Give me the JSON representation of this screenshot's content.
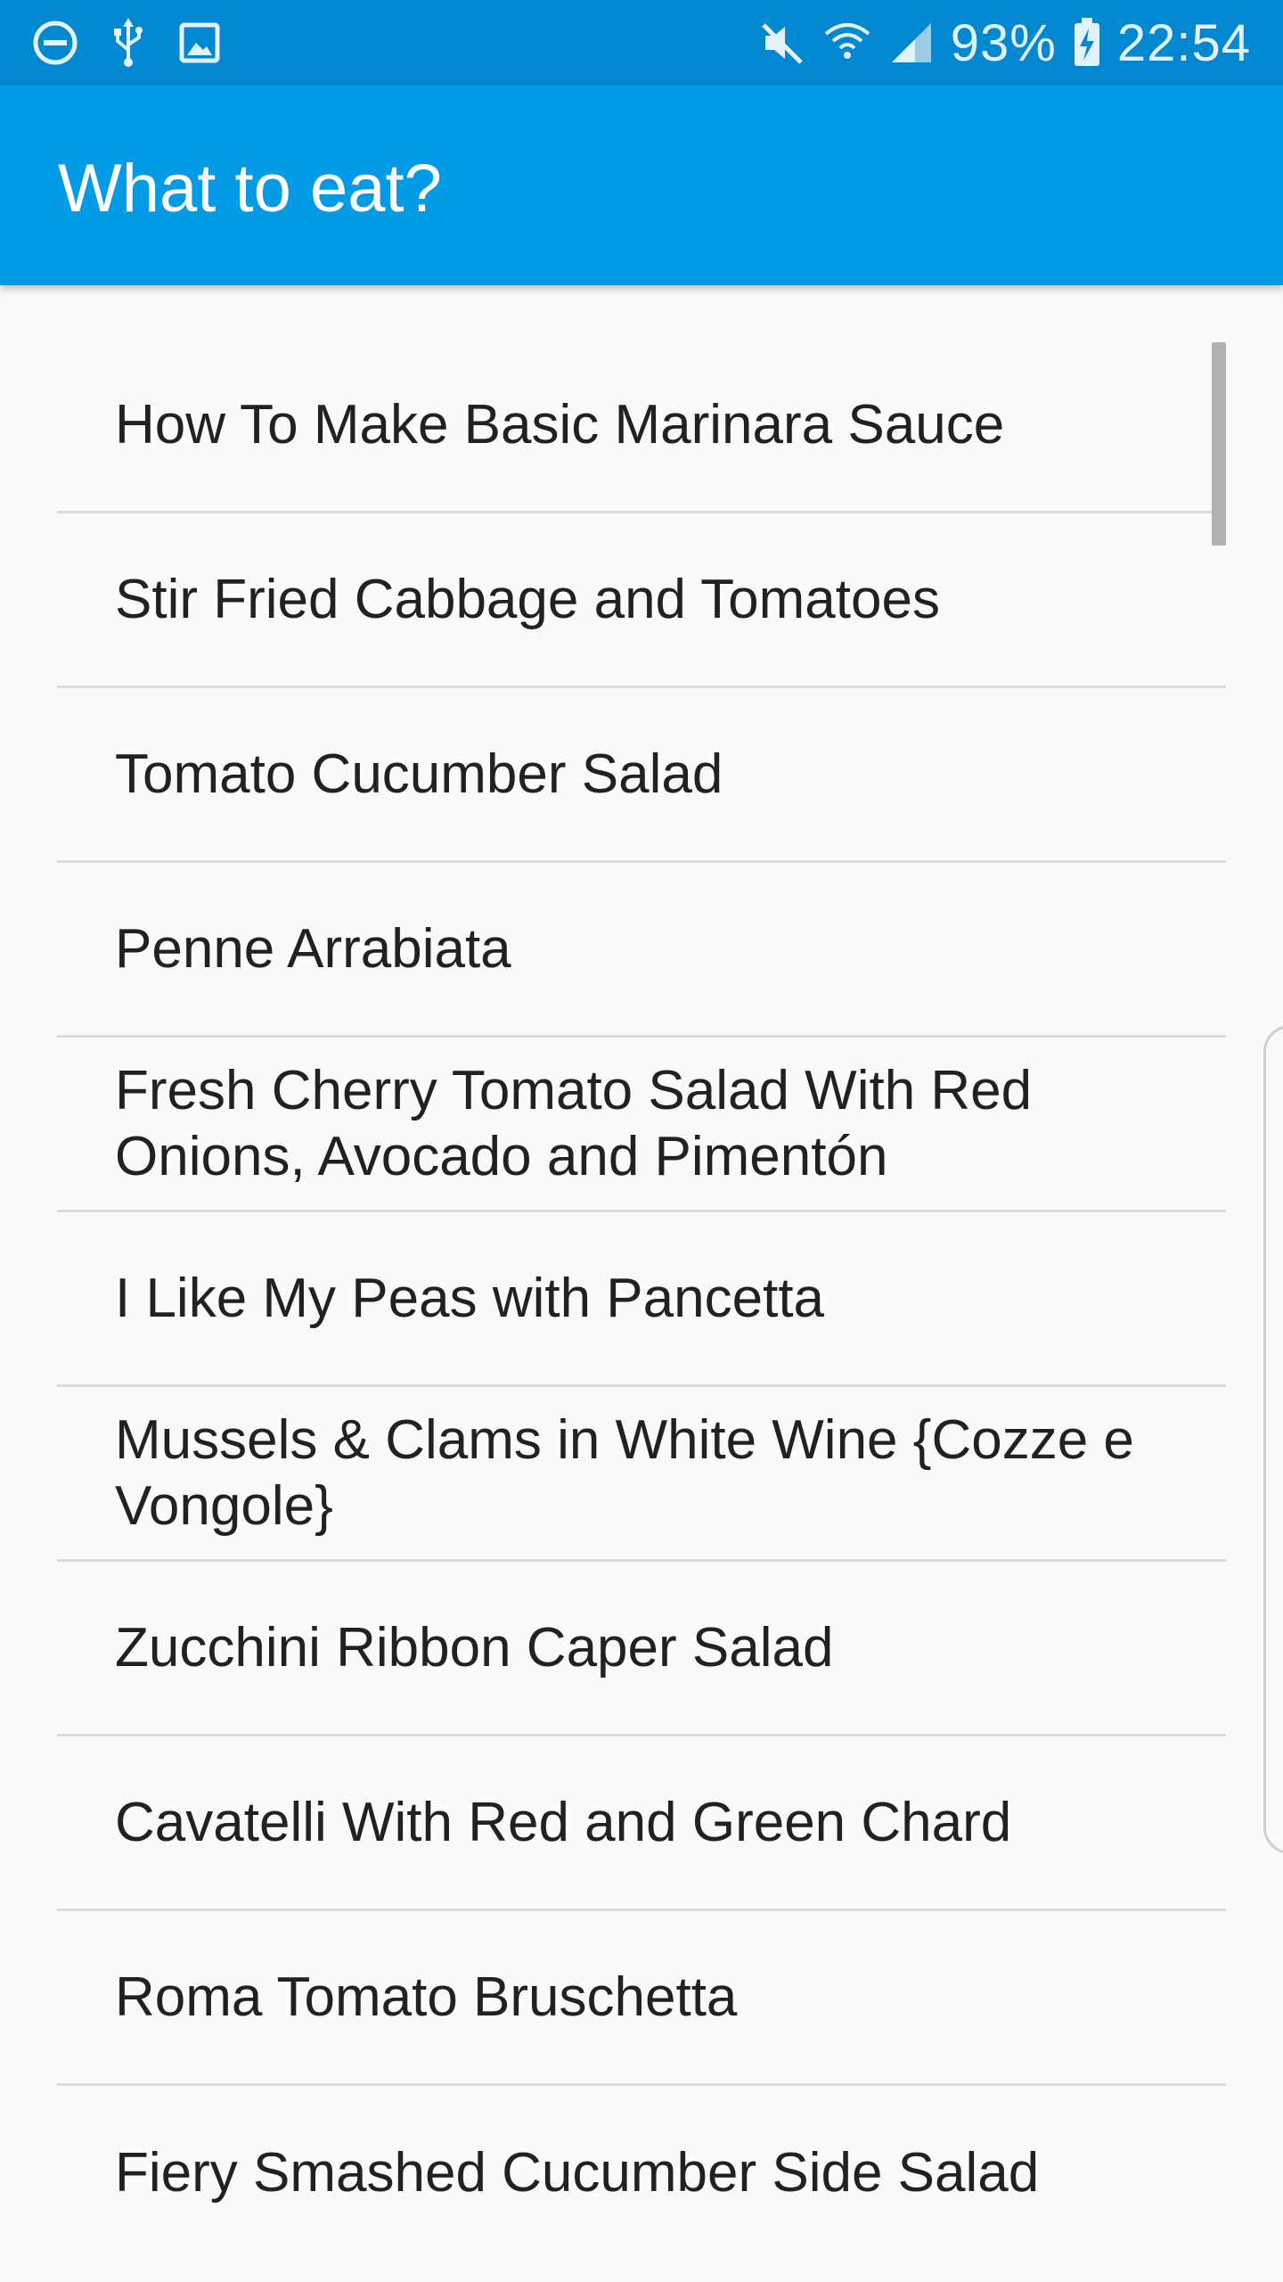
{
  "status_bar": {
    "battery": "93%",
    "time": "22:54",
    "icons_left": [
      "do-not-disturb-icon",
      "usb-icon",
      "image-icon"
    ],
    "icons_right": [
      "mute-icon",
      "wifi-icon",
      "signal-icon",
      "battery-charging-icon"
    ]
  },
  "app_bar": {
    "title": "What to eat?"
  },
  "recipes": [
    "How To Make Basic Marinara Sauce",
    "Stir Fried Cabbage and Tomatoes",
    "Tomato Cucumber Salad",
    "Penne Arrabiata",
    "Fresh Cherry Tomato Salad With Red Onions, Avocado and Pimentón",
    "I Like My Peas with Pancetta",
    "Mussels & Clams in White Wine {Cozze e Vongole}",
    "Zucchini Ribbon Caper Salad",
    "Cavatelli With Red and Green Chard",
    "Roma Tomato Bruschetta",
    "Fiery Smashed Cucumber Side Salad"
  ],
  "colors": {
    "status_bar": "#0288d1",
    "app_bar": "#039be5",
    "background": "#fafafa",
    "divider": "#dcdcdc",
    "text": "#212121"
  }
}
